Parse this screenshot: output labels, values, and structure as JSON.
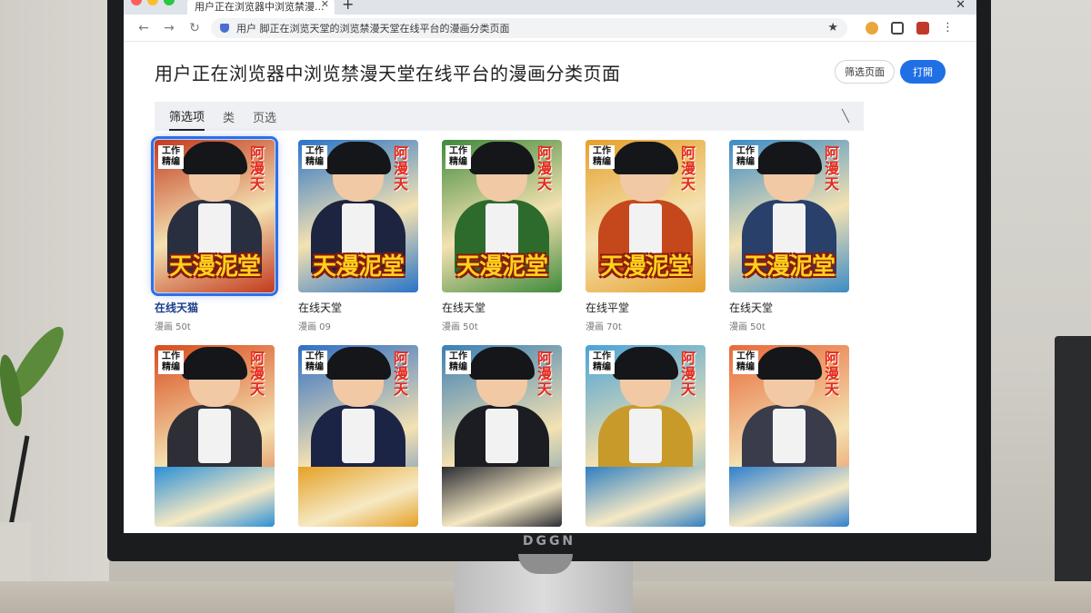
{
  "browser": {
    "tab_title": "用户正在浏览器中浏览禁漫...",
    "address": "用户 脚正在浏览天堂的浏览禁漫天堂在线平台的漫画分类页面",
    "window_controls": [
      "red",
      "yellow",
      "green"
    ]
  },
  "page": {
    "title": "用户正在浏览器中浏览禁漫天堂在线平台的漫画分类页面",
    "btn_filter": "筛选页面",
    "btn_primary": "打開"
  },
  "filters": {
    "tabs": [
      "筛选项",
      "类",
      "页选"
    ],
    "active": 0
  },
  "covers": {
    "logo": "天漫泥堂",
    "corner_left": "工作精编",
    "corner_right": "阿漫天"
  },
  "row1": [
    {
      "title": "在线天猫",
      "meta": "漫画 50t",
      "bg": "#c23a1e",
      "body": "#2a2f40",
      "selected": true
    },
    {
      "title": "在线天堂",
      "meta": "漫画 09",
      "bg": "#2a74c8",
      "body": "#1d2440",
      "selected": false
    },
    {
      "title": "在线天堂",
      "meta": "漫画 50t",
      "bg": "#3f8a3c",
      "body": "#2d6b2c",
      "selected": false
    },
    {
      "title": "在线平堂",
      "meta": "漫画 70t",
      "bg": "#e6a02b",
      "body": "#c4481c",
      "selected": false
    },
    {
      "title": "在线天堂",
      "meta": "漫画 50t",
      "bg": "#3c8cc6",
      "body": "#28406a",
      "selected": false
    }
  ],
  "row2": [
    {
      "bg": "#d84b1c",
      "body": "#2e2e36",
      "lower": "#2a8fd6"
    },
    {
      "bg": "#2f6ec4",
      "body": "#1c2446",
      "lower": "#e5a126"
    },
    {
      "bg": "#3b7fb5",
      "body": "#1b1d22",
      "lower": "#2b2c33"
    },
    {
      "bg": "#4aa3d8",
      "body": "#c89a2a",
      "lower": "#2f7fc2"
    },
    {
      "bg": "#e86a3a",
      "body": "#3a3c4c",
      "lower": "#2e7fd0"
    }
  ],
  "monitor": {
    "brand": "DGGN"
  }
}
